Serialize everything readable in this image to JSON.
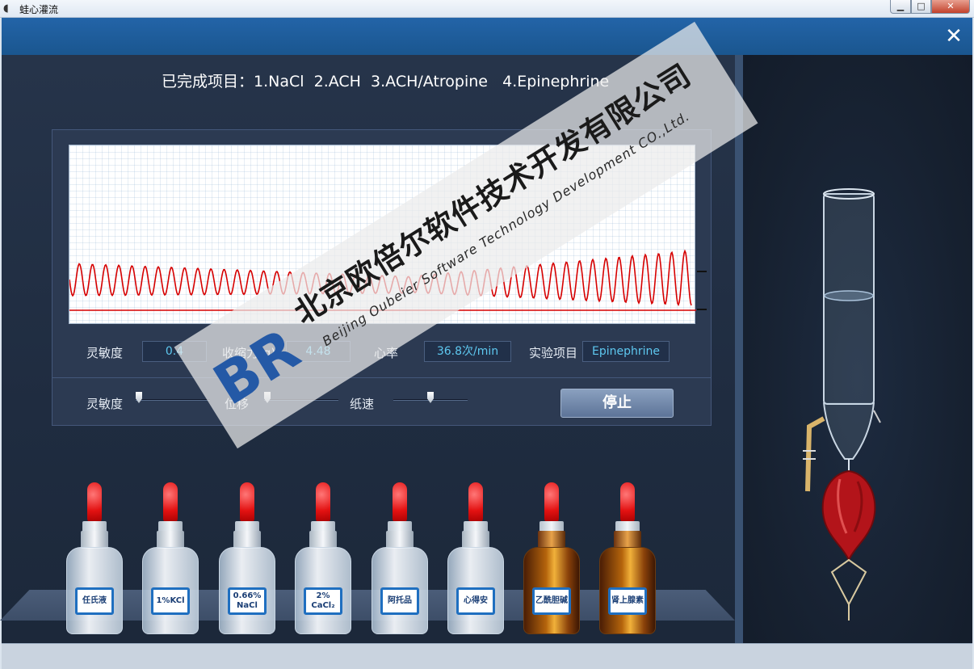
{
  "window": {
    "title": "蛙心灌流",
    "title_icon": "frog-icon",
    "minimize_glyph": "▁",
    "maximize_glyph": "□",
    "close_glyph": "✕"
  },
  "header": {
    "close_glyph": "✕"
  },
  "completed": {
    "text": "已完成项目：1.NaCl  2.ACH  3.ACH/Atropine   4.Epinephrine"
  },
  "readouts": {
    "sensitivity_label": "灵敏度",
    "sensitivity_value": "0.4",
    "force_label": "收缩力(g)",
    "force_value": "4.48",
    "heart_rate_label": "心率",
    "heart_rate_value": "36.8次/min",
    "experiment_label": "实验项目",
    "experiment_value": "Epinephrine"
  },
  "controls": {
    "sensitivity_label": "灵敏度",
    "displacement_label": "位移",
    "paper_speed_label": "纸速",
    "stop_label": "停止",
    "sensitivity_level": 0.0,
    "displacement_level": 0.0,
    "paper_speed_level": 0.5
  },
  "bottles": [
    {
      "label": "任氏液",
      "amber": false
    },
    {
      "label": "1%KCl",
      "amber": false
    },
    {
      "label": "0.66%\nNaCl",
      "amber": false
    },
    {
      "label": "2%\nCaCl₂",
      "amber": false
    },
    {
      "label": "阿托品",
      "amber": false
    },
    {
      "label": "心得安",
      "amber": false
    },
    {
      "label": "乙酰胆碱",
      "amber": true
    },
    {
      "label": "肾上腺素",
      "amber": true
    }
  ],
  "watermark": {
    "logo": "BR",
    "company_cn": "北京欧倍尔软件技术开发有限公司",
    "company_en": "Beijing Oubeier Software Technology Development CO.,Ltd."
  },
  "colors": {
    "header": "#1a568f",
    "trace": "#d60000",
    "accent_text": "#5ec8f0"
  }
}
